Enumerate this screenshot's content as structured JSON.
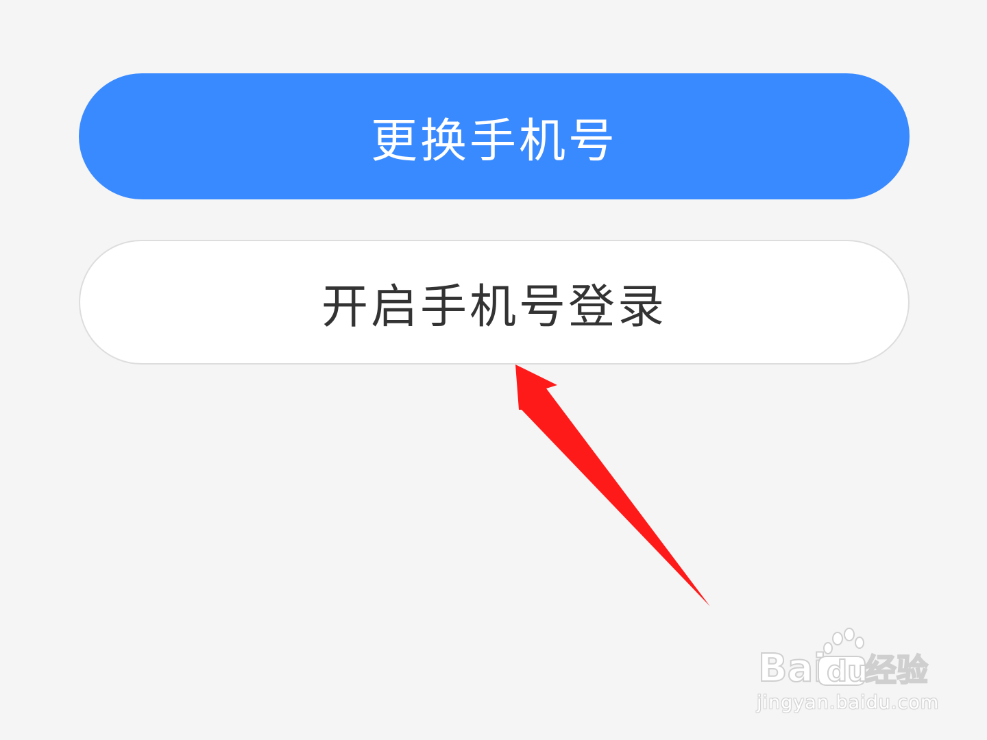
{
  "buttons": {
    "change_phone_label": "更换手机号",
    "enable_phone_login_label": "开启手机号登录"
  },
  "annotation": {
    "arrow_color": "#ff1a1a",
    "arrow_icon": "red-arrow-icon"
  },
  "watermark": {
    "logo_text": "Bai经验",
    "url": "jingyan.baidu.com"
  },
  "colors": {
    "primary": "#3a8aff",
    "background": "#f5f5f5",
    "secondary_text": "#333333"
  }
}
